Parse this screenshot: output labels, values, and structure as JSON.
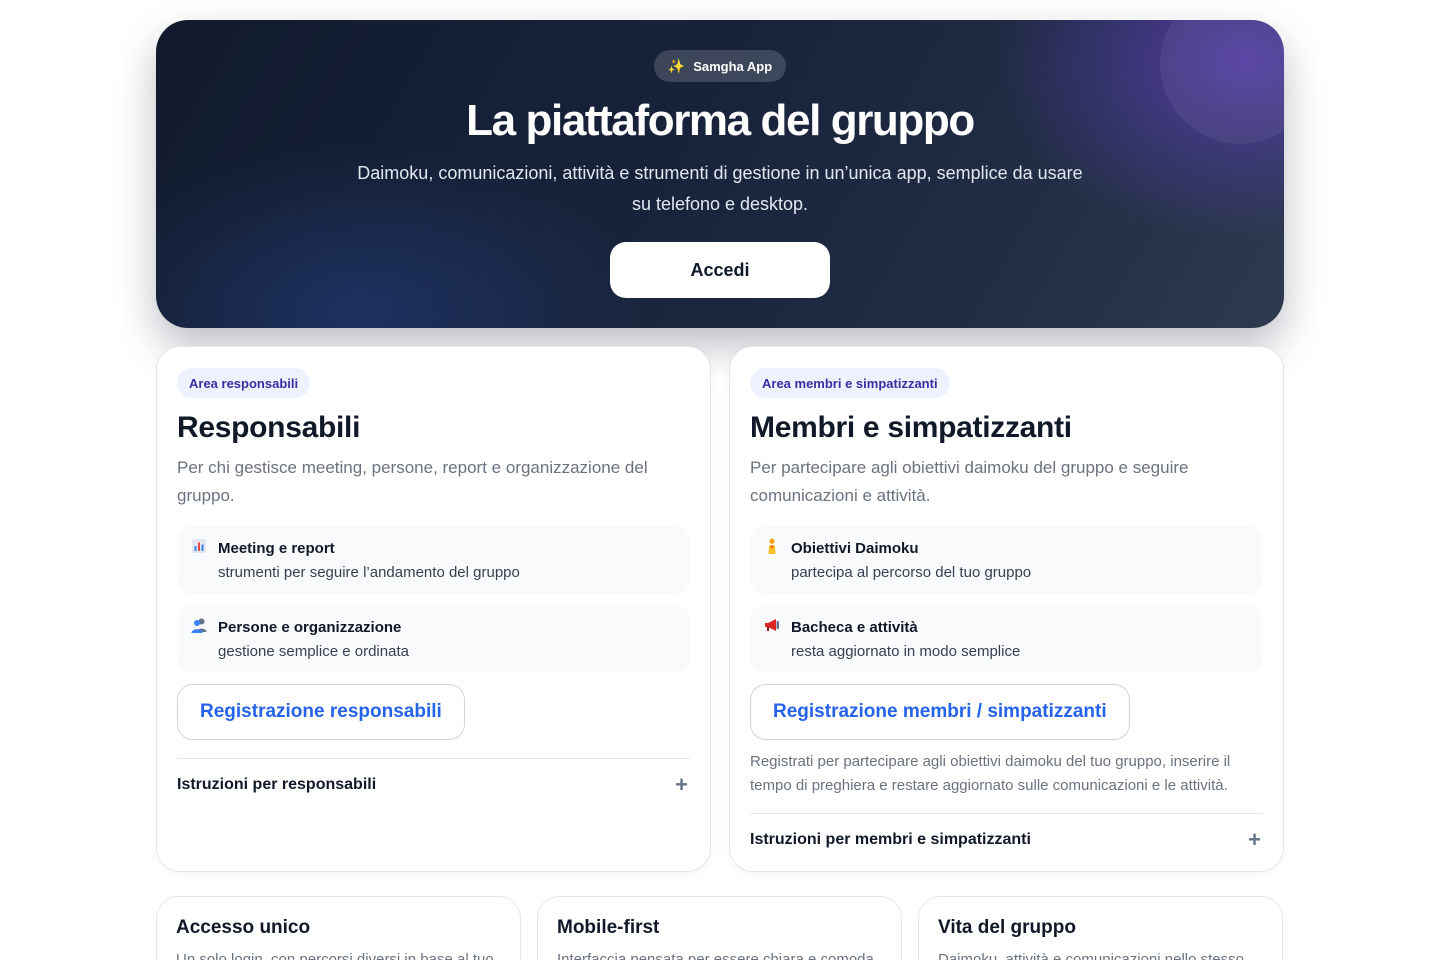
{
  "hero": {
    "badge_icon": "sparkles-icon",
    "badge_label": "Samgha App",
    "title": "La piattaforma del gruppo",
    "subtitle": "Daimoku, comunicazioni, attività e strumenti di gestione in un’unica app, semplice da usare su telefono e desktop.",
    "cta_label": "Accedi"
  },
  "responsabili": {
    "pill": "Area responsabili",
    "title": "Responsabili",
    "description": "Per chi gestisce meeting, persone, report e organizzazione del gruppo.",
    "features": [
      {
        "icon": "bar-chart-icon",
        "title": "Meeting e report",
        "subtitle": "strumenti per seguire l’andamento del gruppo"
      },
      {
        "icon": "people-icon",
        "title": "Persone e organizzazione",
        "subtitle": "gestione semplice e ordinata"
      }
    ],
    "register_label": "Registrazione responsabili",
    "instructions_label": "Istruzioni per responsabili"
  },
  "membri": {
    "pill": "Area membri e simpatizzanti",
    "title": "Membri e simpatizzanti",
    "description": "Per partecipare agli obiettivi daimoku del gruppo e seguire comunicazioni e attività.",
    "features": [
      {
        "icon": "person-praying-icon",
        "title": "Obiettivi Daimoku",
        "subtitle": "partecipa al percorso del tuo gruppo"
      },
      {
        "icon": "megaphone-icon",
        "title": "Bacheca e attività",
        "subtitle": "resta aggiornato in modo semplice"
      }
    ],
    "register_label": "Registrazione membri / simpatizzanti",
    "register_note": "Registrati per partecipare agli obiettivi daimoku del tuo gruppo, inserire il tempo di preghiera e restare aggiornato sulle comunicazioni e le attività.",
    "instructions_label": "Istruzioni per membri e simpatizzanti"
  },
  "bottom_cards": [
    {
      "title": "Accesso unico",
      "text": "Un solo login, con percorsi diversi in base al tuo"
    },
    {
      "title": "Mobile-first",
      "text": "Interfaccia pensata per essere chiara e comoda"
    },
    {
      "title": "Vita del gruppo",
      "text": "Daimoku, attività e comunicazioni nello stesso"
    }
  ],
  "colors": {
    "accent_blue": "#2563eb",
    "pill_text": "#3730a3",
    "hero_dark": "#111a2c"
  }
}
